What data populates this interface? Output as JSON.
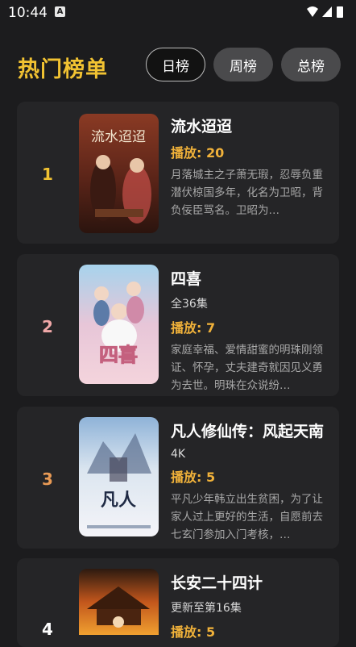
{
  "status": {
    "time": "10:44",
    "badge": "A"
  },
  "header": {
    "title": "热门榜单"
  },
  "tabs": [
    "日榜",
    "周榜",
    "总榜"
  ],
  "colors": {
    "accent": "#f1c232",
    "plays": "#f1b23a",
    "card": "#252527",
    "background": "#1c1c1e"
  },
  "items": [
    {
      "rank": "1",
      "rank_color": "#f1c232",
      "title": "流水迢迢",
      "episodes": "",
      "plays": "播放: 20",
      "desc": "月落城主之子萧无瑕，忍辱负重潜伏椋国多年，化名为卫昭，背负佞臣骂名。卫昭为…",
      "poster_text": "流水迢迢"
    },
    {
      "rank": "2",
      "rank_color": "#f0a8a8",
      "title": "四喜",
      "episodes": "全36集",
      "plays": "播放: 7",
      "desc": "家庭幸福、爱情甜蜜的明珠刚领证、怀孕，丈夫建奇就因见义勇为去世。明珠在众说纷…",
      "poster_text": "四喜"
    },
    {
      "rank": "3",
      "rank_color": "#e89a55",
      "title": "凡人修仙传：风起天南",
      "episodes": "4K",
      "plays": "播放: 5",
      "desc": "平凡少年韩立出生贫困，为了让家人过上更好的生活，自愿前去七玄门参加入门考核，…",
      "poster_text": "凡人"
    },
    {
      "rank": "4",
      "rank_color": "#ffffff",
      "title": "长安二十四计",
      "episodes": "更新至第16集",
      "plays": "播放: 5",
      "desc": "",
      "poster_text": ""
    }
  ]
}
